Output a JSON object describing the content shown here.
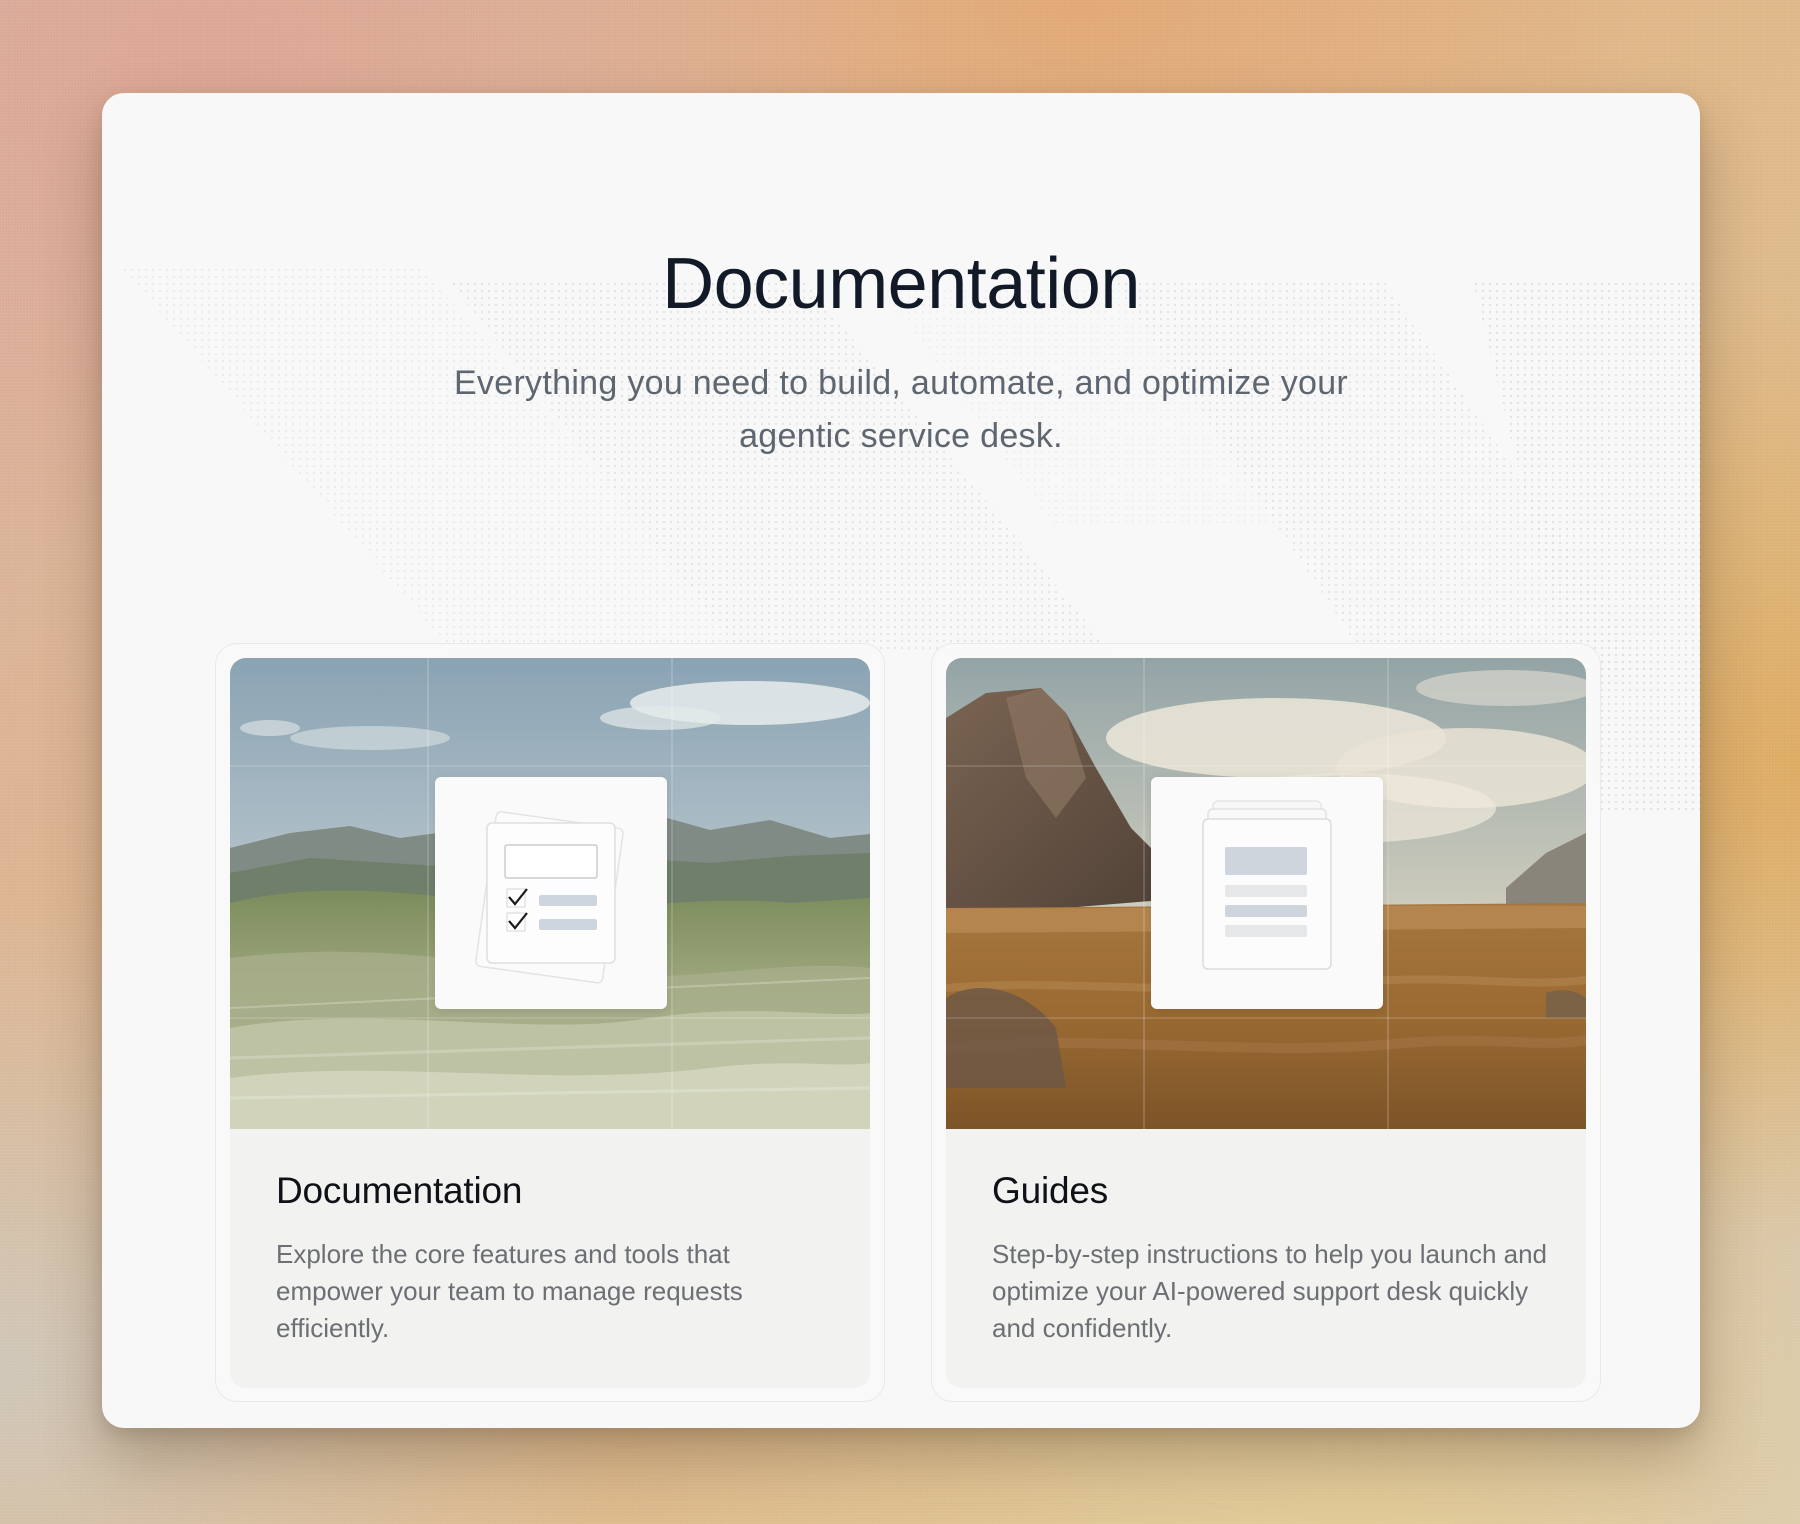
{
  "hero": {
    "title": "Documentation",
    "subtitle": "Everything you need to build, automate, and optimize your agentic service desk."
  },
  "cards": [
    {
      "title": "Documentation",
      "description": "Explore the core features and tools that empower your team to manage requests efficiently.",
      "illustration": "checklist-document-icon",
      "background": "green-grassland-hills"
    },
    {
      "title": "Guides",
      "description": "Step-by-step instructions to help you launch and optimize your AI-powered support desk quickly and confidently.",
      "illustration": "stacked-pages-icon",
      "background": "golden-prairie-mountain"
    }
  ],
  "colors": {
    "page_background": "#f8f8f8",
    "title_text": "#121a27",
    "subtitle_text": "#5e6670",
    "card_text": "#6c6f74"
  }
}
